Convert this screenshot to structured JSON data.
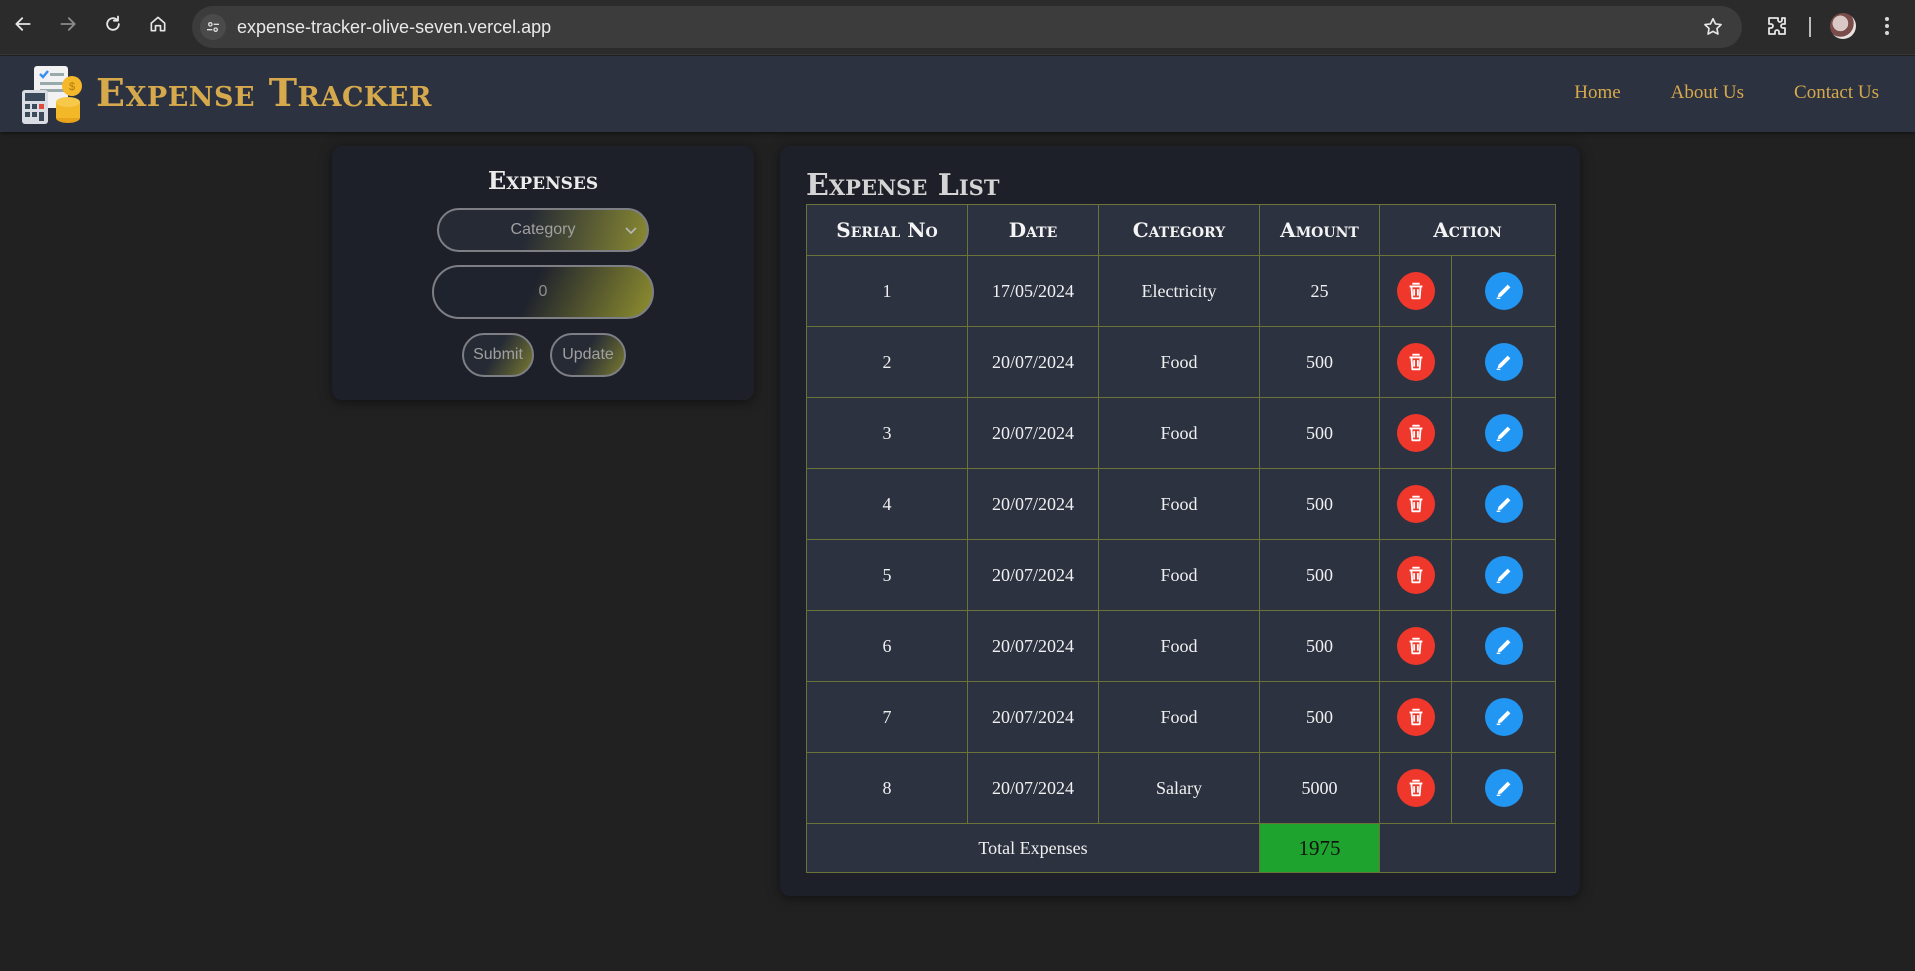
{
  "browser": {
    "url": "expense-tracker-olive-seven.vercel.app"
  },
  "header": {
    "brand": "Expense Tracker",
    "nav": [
      "Home",
      "About Us",
      "Contact Us"
    ]
  },
  "form": {
    "title": "Expenses",
    "category_placeholder": "Category",
    "amount_value": "0",
    "submit_label": "Submit",
    "update_label": "Update"
  },
  "list": {
    "title": "Expense List",
    "columns": [
      "Serial No",
      "Date",
      "Category",
      "Amount",
      "Action"
    ],
    "rows": [
      {
        "serial": "1",
        "date": "17/05/2024",
        "category": "Electricity",
        "amount": "25"
      },
      {
        "serial": "2",
        "date": "20/07/2024",
        "category": "Food",
        "amount": "500"
      },
      {
        "serial": "3",
        "date": "20/07/2024",
        "category": "Food",
        "amount": "500"
      },
      {
        "serial": "4",
        "date": "20/07/2024",
        "category": "Food",
        "amount": "500"
      },
      {
        "serial": "5",
        "date": "20/07/2024",
        "category": "Food",
        "amount": "500"
      },
      {
        "serial": "6",
        "date": "20/07/2024",
        "category": "Food",
        "amount": "500"
      },
      {
        "serial": "7",
        "date": "20/07/2024",
        "category": "Food",
        "amount": "500"
      },
      {
        "serial": "8",
        "date": "20/07/2024",
        "category": "Salary",
        "amount": "5000"
      }
    ],
    "total_label": "Total Expenses",
    "total_value": "1975"
  },
  "icons": {
    "back": "arrow-left-icon",
    "forward": "arrow-right-icon",
    "reload": "reload-icon",
    "home": "home-icon",
    "site_settings": "tune-icon",
    "bookmark": "star-icon",
    "extensions": "puzzle-icon",
    "menu": "kebab-menu-icon",
    "delete": "trash-icon",
    "edit": "pencil-icon"
  },
  "colors": {
    "accent_gold": "#d6a94c",
    "delete_red": "#f0372b",
    "edit_blue": "#2196f3",
    "total_green": "#1fa32f"
  }
}
